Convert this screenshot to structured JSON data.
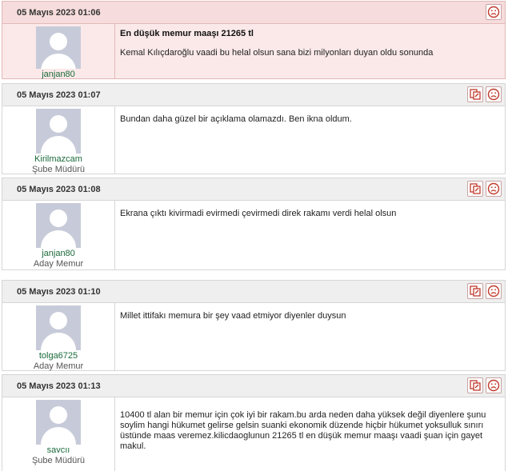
{
  "icons": {
    "quote": "quote-icon",
    "report": "sad-face-report-icon"
  },
  "colors": {
    "first_post_bg": "#fbe9e9",
    "username": "#1a6a3a",
    "avatar": "#c7cbd9",
    "header_bg": "#efefef"
  },
  "posts": [
    {
      "date": "05 Mayıs 2023 01:06",
      "username": "janjan80",
      "rank": "",
      "title": "En düşük memur maaşı 21265 tl",
      "text": "Kemal Kılıçdaroğlu vaadi bu helal olsun sana bizi milyonları duyan oldu sonunda"
    },
    {
      "date": "05 Mayıs 2023 01:07",
      "username": "Kirilmazcam",
      "rank": "Şube Müdürü",
      "text": "Bundan daha güzel bir açıklama olamazdı. Ben ikna oldum."
    },
    {
      "date": "05 Mayıs 2023 01:08",
      "username": "janjan80",
      "rank": "Aday Memur",
      "text": "Ekrana çıktı kivirmadi evirmedi çevirmedi direk rakamı verdi helal olsun"
    },
    {
      "date": "05 Mayıs 2023 01:10",
      "username": "tolga6725",
      "rank": "Aday Memur",
      "text": "Millet ittifakı memura bir şey vaad etmiyor diyenler duysun"
    },
    {
      "date": "05 Mayıs 2023 01:13",
      "username": "savcıı",
      "rank": "Şube Müdürü",
      "text": "10400 tl alan bir memur için çok iyi bir rakam.bu arda neden daha yüksek değil diyenlere şunu soylim hangi hükumet gelirse gelsin suanki ekonomik düzende hiçbir hükumet yoksulluk sınırı üstünde maas veremez.kilicdaoglunun 21265 tl en düşük memur maaşı vaadi şuan için gayet makul."
    }
  ]
}
